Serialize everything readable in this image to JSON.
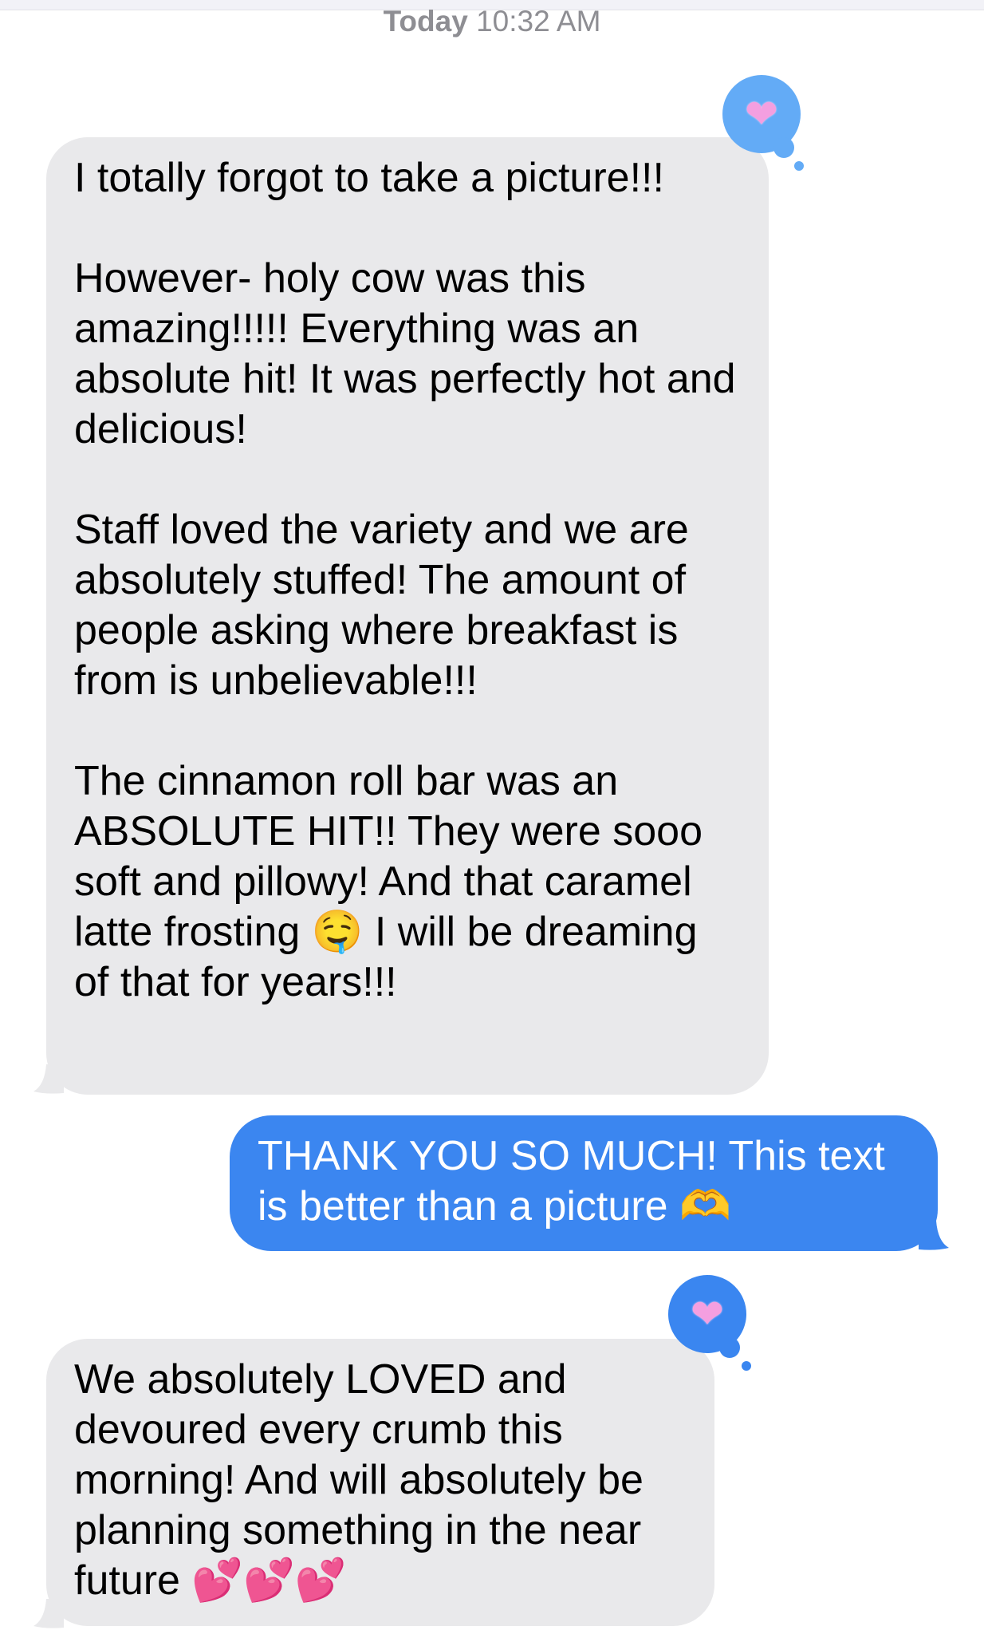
{
  "header": {
    "day": "Today",
    "time": "10:32 AM"
  },
  "messages": [
    {
      "direction": "incoming",
      "text": "I totally forgot to take a picture!!!\n\nHowever- holy cow was this amazing!!!!! Everything was an absolute hit! It was perfectly hot and delicious!\n\nStaff loved the variety and we are absolutely stuffed! The amount of people asking where breakfast is from is unbelievable!!!\n\nThe cinnamon roll bar was an ABSOLUTE HIT!! They were sooo soft and pillowy! And that caramel latte frosting 🤤 I will be dreaming of that for years!!!",
      "reaction": "❤"
    },
    {
      "direction": "outgoing",
      "text": "THANK YOU SO MUCH! This text is better than a picture 🫶"
    },
    {
      "direction": "incoming",
      "text": "We absolutely LOVED and devoured every crumb this morning! And will absolutely be planning something in the near future 💕💕💕",
      "reaction": "❤"
    }
  ],
  "colors": {
    "incoming_bubble": "#e9e9eb",
    "outgoing_bubble": "#3b86f0",
    "reaction_bubble": "#63abf6",
    "timestamp_text": "#8e8e93"
  }
}
